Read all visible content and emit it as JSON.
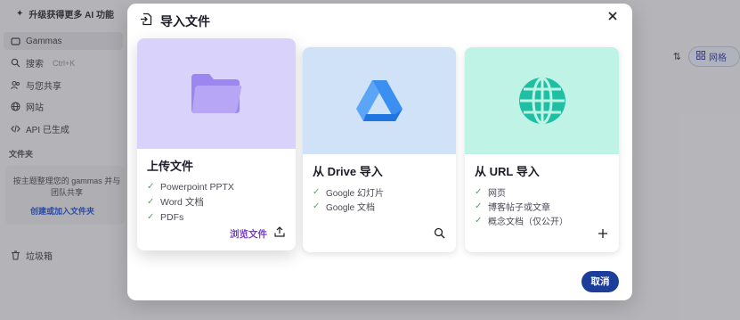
{
  "topbar": {
    "upgrade_text": "升级获得更多 AI 功能"
  },
  "sidebar": {
    "items": [
      {
        "label": "Gammas",
        "icon": "gammas-icon"
      },
      {
        "label": "搜索",
        "shortcut": "Ctrl+K",
        "icon": "search-icon"
      },
      {
        "label": "与您共享",
        "icon": "users-icon"
      },
      {
        "label": "网站",
        "icon": "globe-icon"
      },
      {
        "label": "API 已生成",
        "icon": "code-icon"
      }
    ],
    "folders_label": "文件夹",
    "folders_hint": "按主题整理您的 gammas 并与团队共享",
    "folders_link": "创建或加入文件夹",
    "trash_label": "垃圾箱"
  },
  "toolbar": {
    "grid_label": "网格"
  },
  "modal": {
    "title": "导入文件",
    "cards": [
      {
        "title": "上传文件",
        "features": [
          "Powerpoint PPTX",
          "Word 文档",
          "PDFs"
        ],
        "action_label": "浏览文件",
        "accent": "#d9d3fb"
      },
      {
        "title": "从 Drive 导入",
        "features": [
          "Google 幻灯片",
          "Google 文档"
        ],
        "accent": "#cfe2f8"
      },
      {
        "title": "从 URL 导入",
        "features": [
          "网页",
          "博客帖子或文章",
          "概念文档（仅公开）"
        ],
        "accent": "#bff3e6"
      }
    ],
    "cancel_label": "取消"
  }
}
